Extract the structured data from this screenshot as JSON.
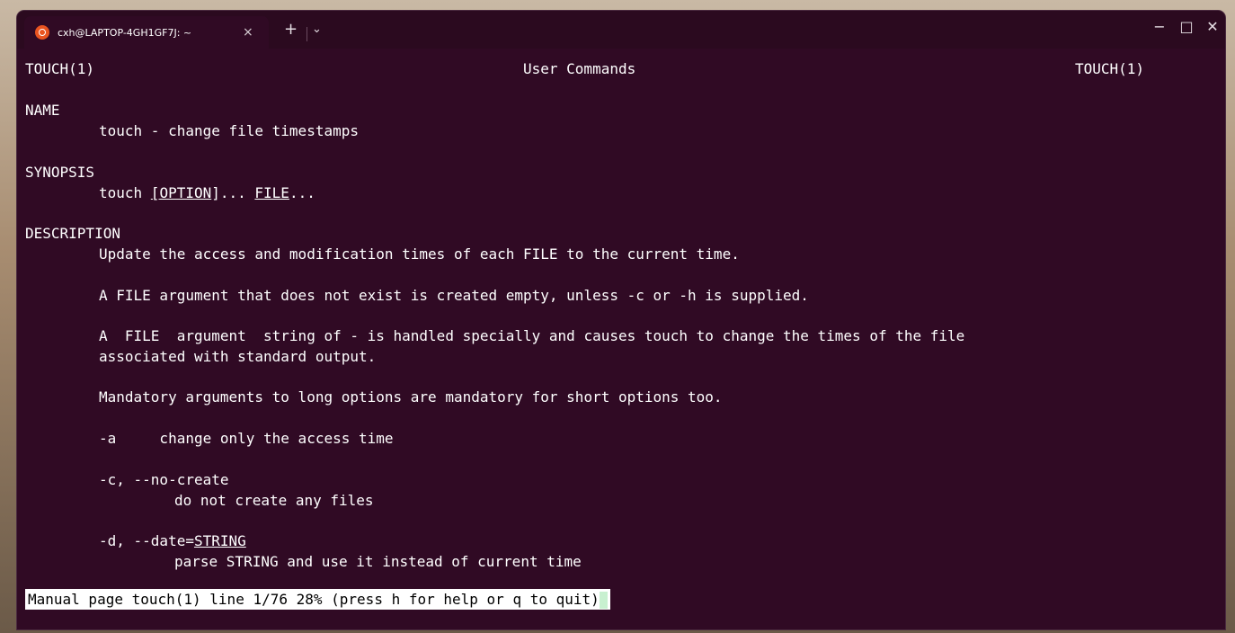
{
  "window": {
    "tab_title": "cxh@LAPTOP-4GH1GF7J: ~",
    "tab_close": "×",
    "new_tab": "+",
    "dropdown": "⌄",
    "minimize": "−",
    "maximize": "□",
    "close": "✕"
  },
  "man": {
    "header_left": "TOUCH(1)",
    "header_center": "User Commands",
    "header_right": "TOUCH(1)",
    "name_heading": "NAME",
    "name_text": "touch - change file timestamps",
    "synopsis_heading": "SYNOPSIS",
    "synopsis_cmd": "touch ",
    "synopsis_bracket_open": "[",
    "synopsis_option": "OPTION",
    "synopsis_bracket_close": "]... ",
    "synopsis_file": "FILE",
    "synopsis_tail": "...",
    "description_heading": "DESCRIPTION",
    "desc_1": "Update the access and modification times of each FILE to the current time.",
    "desc_2": "A FILE argument that does not exist is created empty, unless -c or -h is supplied.",
    "desc_3a": "A  FILE  argument  string of - is handled specially and causes touch to change the times of the file",
    "desc_3b": "associated with standard output.",
    "desc_4": "Mandatory arguments to long options are mandatory for short options too.",
    "opt_a": "-a     change only the access time",
    "opt_c": "-c, --no-create",
    "opt_c_desc": "do not create any files",
    "opt_d_prefix": "-d, --date=",
    "opt_d_arg": "STRING",
    "opt_d_desc": "parse STRING and use it instead of current time"
  },
  "status": {
    "text": "Manual page touch(1) line 1/76 28% (press h for help or q to quit)"
  },
  "colors": {
    "terminal_bg": "#300a24",
    "terminal_fg": "#ffffff",
    "ubuntu_orange": "#e95420"
  }
}
